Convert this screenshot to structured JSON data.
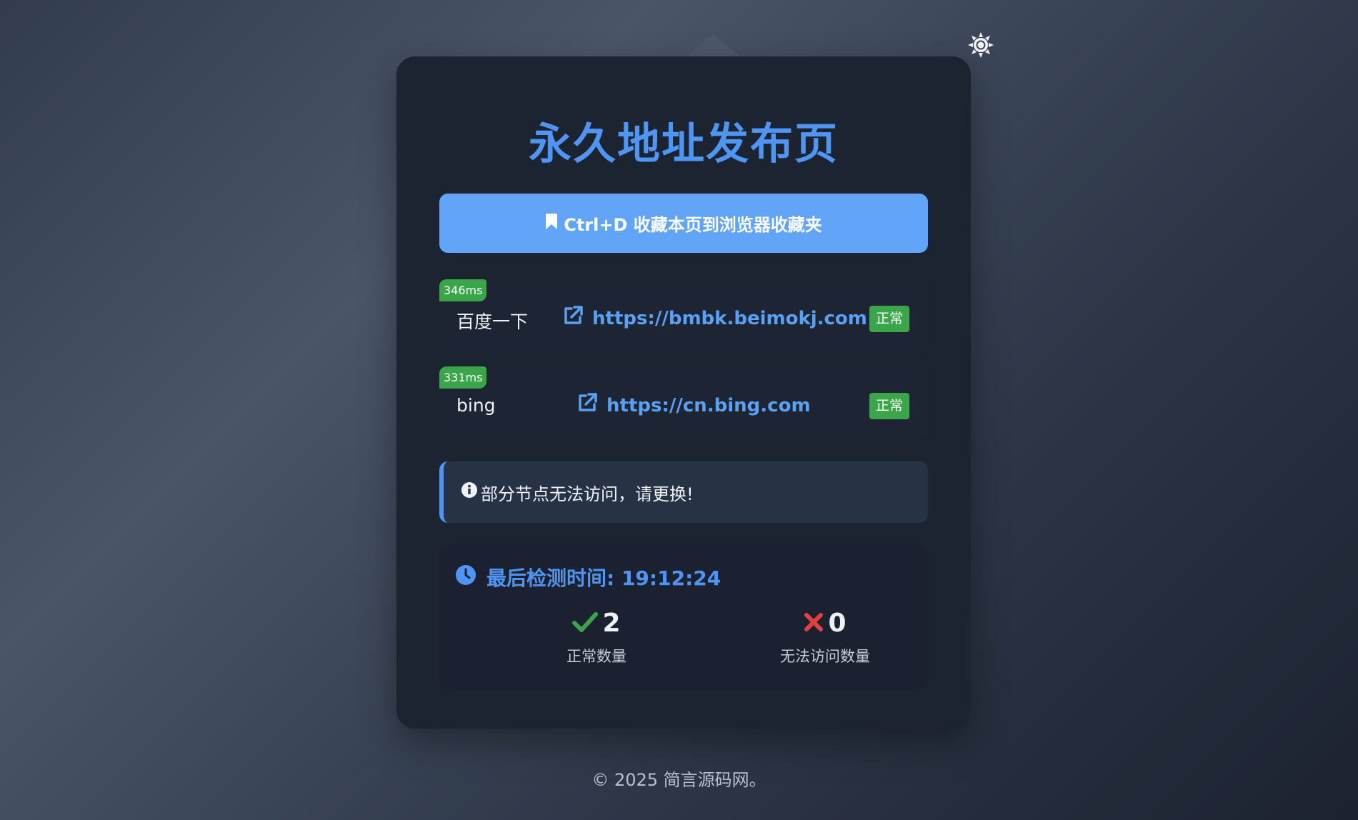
{
  "theme_toggle": {
    "icon": "sun-icon"
  },
  "page": {
    "title": "永久地址发布页",
    "bookmark_button": {
      "icon": "bookmark-icon",
      "label": "Ctrl+D 收藏本页到浏览器收藏夹"
    }
  },
  "sites": [
    {
      "latency": "346ms",
      "name": "百度一下",
      "url": "https://bmbk.beimokj.com",
      "status": "正常",
      "link_icon": "external-link-icon"
    },
    {
      "latency": "331ms",
      "name": "bing",
      "url": "https://cn.bing.com",
      "status": "正常",
      "link_icon": "external-link-icon"
    }
  ],
  "notice": {
    "icon": "info-icon",
    "text": "部分节点无法访问，请更换!"
  },
  "stats": {
    "check_time_label": "最后检测时间: 19:12:24",
    "normal": {
      "value": "2",
      "label": "正常数量",
      "icon": "check-icon"
    },
    "failed": {
      "value": "0",
      "label": "无法访问数量",
      "icon": "cross-icon"
    }
  },
  "footer": {
    "text": "© 2025 简言源码网。"
  },
  "colors": {
    "accent": "#4f95f3",
    "button": "#62a4f8",
    "success": "#3aa549",
    "error": "#e53e3e"
  }
}
